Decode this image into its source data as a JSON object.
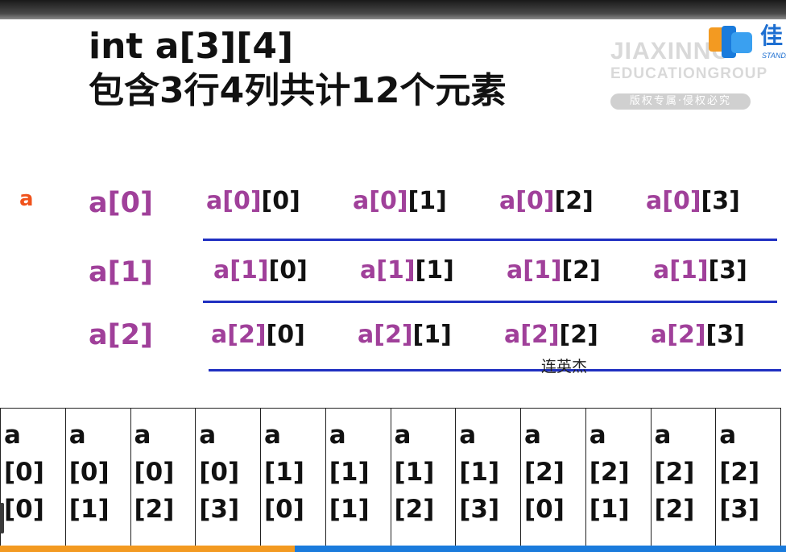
{
  "title": {
    "line1": "int a[3][4]",
    "line2": "包含3行4列共计12个元素"
  },
  "watermark": {
    "line1": "JIAXINNO",
    "line2": "EDUCATIONGROUP",
    "pill": "版权专属·侵权必究"
  },
  "logo": {
    "chinese": "佳",
    "sub": "STANDA"
  },
  "array_name": "a",
  "rows": [
    {
      "label": "a[1]",
      "cells": []
    }
  ],
  "grid": {
    "row_labels": [
      "a[0]",
      "a[1]",
      "a[2]"
    ],
    "cells": [
      [
        {
          "prefix": "a[0]",
          "index": "[0]"
        },
        {
          "prefix": "a[0]",
          "index": "[1]"
        },
        {
          "prefix": "a[0]",
          "index": "[2]"
        },
        {
          "prefix": "a[0]",
          "index": "[3]"
        }
      ],
      [
        {
          "prefix": "a[1]",
          "index": "[0]"
        },
        {
          "prefix": "a[1]",
          "index": "[1]"
        },
        {
          "prefix": "a[1]",
          "index": "[2]"
        },
        {
          "prefix": "a[1]",
          "index": "[3]"
        }
      ],
      [
        {
          "prefix": "a[2]",
          "index": "[0]"
        },
        {
          "prefix": "a[2]",
          "index": "[1]"
        },
        {
          "prefix": "a[2]",
          "index": "[2]"
        },
        {
          "prefix": "a[2]",
          "index": "[3]"
        }
      ]
    ]
  },
  "caption": "连英杰",
  "memory": [
    [
      "a",
      "[0]",
      "[0]"
    ],
    [
      "a",
      "[0]",
      "[1]"
    ],
    [
      "a",
      "[0]",
      "[2]"
    ],
    [
      "a",
      "[0]",
      "[3]"
    ],
    [
      "a",
      "[1]",
      "[0]"
    ],
    [
      "a",
      "[1]",
      "[1]"
    ],
    [
      "a",
      "[1]",
      "[2]"
    ],
    [
      "a",
      "[1]",
      "[3]"
    ],
    [
      "a",
      "[2]",
      "[0]"
    ],
    [
      "a",
      "[2]",
      "[1]"
    ],
    [
      "a",
      "[2]",
      "[2]"
    ],
    [
      "a",
      "[2]",
      "[3]"
    ]
  ],
  "colors": {
    "purple": "#a0409a",
    "orange": "#f0531c",
    "line_blue": "#1f2fc1"
  }
}
